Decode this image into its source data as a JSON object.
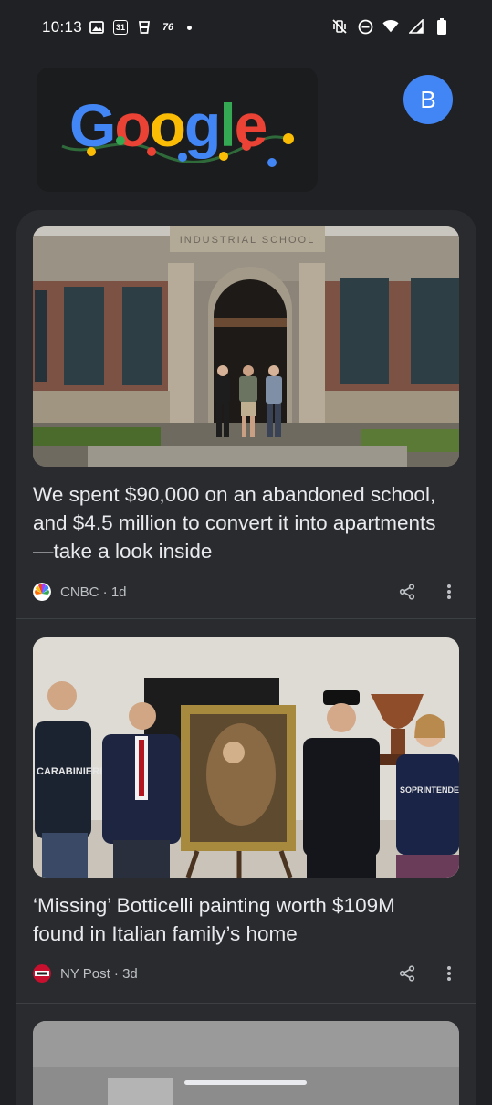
{
  "status_bar": {
    "time": "10:13",
    "calendar_date": "31",
    "weather_temp": "76"
  },
  "header": {
    "doodle_text": "Google",
    "doodle_colors": [
      "#4285f4",
      "#ea4335",
      "#fbbc05",
      "#4285f4",
      "#34a853",
      "#ea4335"
    ],
    "avatar_letter": "B",
    "avatar_color": "#4285f4"
  },
  "feed": {
    "cards": [
      {
        "headline": "We spent $90,000 on an abandoned school, and $4.5 million to convert it into apartments—take a look inside",
        "source": "CNBC",
        "age": "1d",
        "meta": "CNBC · 1d",
        "image_sign": "INDUSTRIAL SCHOOL"
      },
      {
        "headline": "‘Missing’ Botticelli painting worth $109M found in Italian family’s home",
        "source": "NY Post",
        "age": "3d",
        "meta": "NY Post · 3d",
        "image_jacket_left": "CARABINIERI TPC",
        "image_jacket_right": "SOPRINTENDENZ"
      }
    ]
  }
}
